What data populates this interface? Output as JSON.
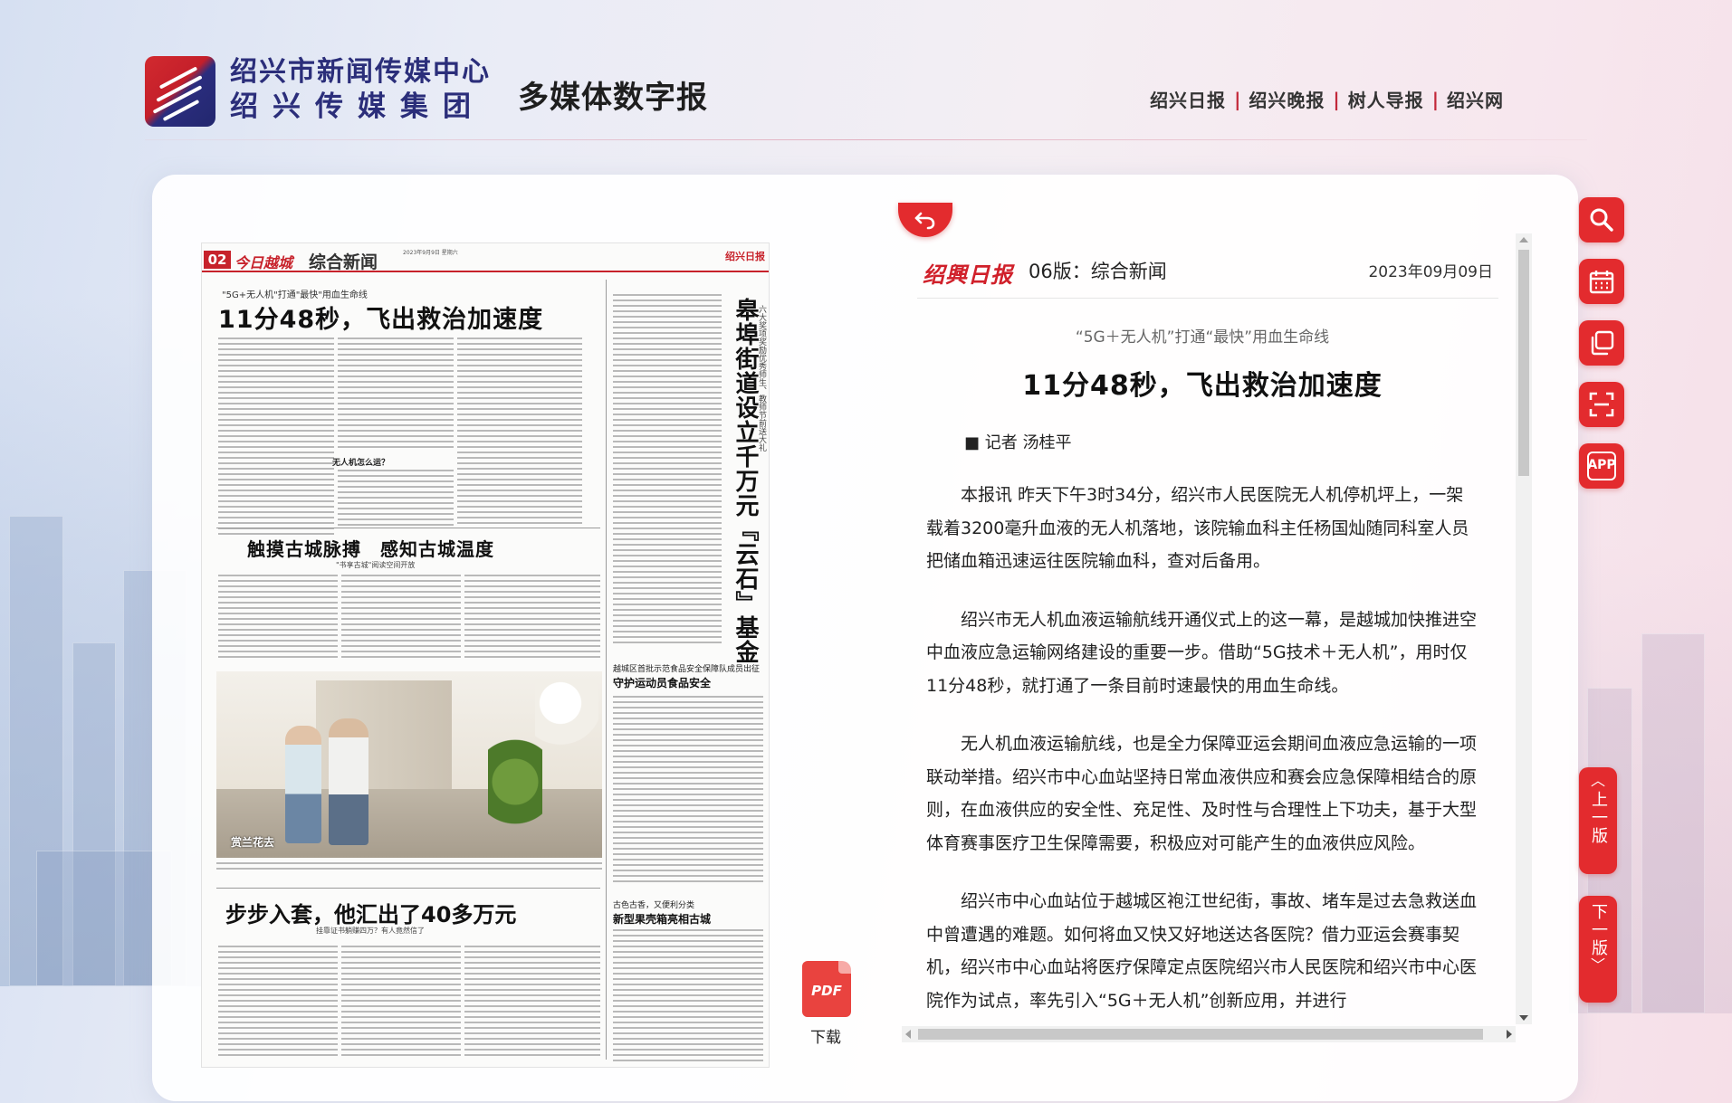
{
  "header": {
    "org_line1": "绍兴市新闻传媒中心",
    "org_line2": "绍兴传媒集团",
    "site_title": "多媒体数字报",
    "nav": [
      "绍兴日报",
      "绍兴晚报",
      "树人导报",
      "绍兴网"
    ],
    "nav_separator": "|"
  },
  "newspaper_page": {
    "page_number": "02",
    "brand": "今日越城",
    "section": "综合新闻",
    "meta_date": "2023年9月9日 星期六",
    "right_logo": "绍兴日报",
    "kicker": "\"5G+无人机\"打通\"最快\"用血生命线",
    "headline": "11分48秒，飞出救治加速度",
    "vertical_title": "皋埠街道设立千万元『云石』基金",
    "vertical_subtitle": "六大奖项奖励优秀师生、教师节前送大礼",
    "box_label": "无人机怎么运？",
    "headline2": "触摸古城脉搏　感知古城温度",
    "headline2_sub": "\"书享古城\"阅读空间开放",
    "mid_kicker": "越城区首批示范食品安全保障队成员出征",
    "mid_title": "守护运动员食品安全",
    "photo_caption": "赏兰花去",
    "headline3": "步步入套，他汇出了40多万元",
    "headline3_sub": "挂靠证书躺赚四万？有人竟然信了",
    "low_kicker": "古色古香，又便利分类",
    "low_title": "新型果壳箱亮相古城"
  },
  "pdf": {
    "icon_label": "PDF",
    "download_label": "下载"
  },
  "article": {
    "brand": "绍興日报",
    "edition": "06版：综合新闻",
    "date": "2023年09月09日",
    "kicker": "“5G＋无人机”打通“最快”用血生命线",
    "title": "11分48秒，飞出救治加速度",
    "byline": "■ 记者 汤桂平",
    "paragraphs": [
      "本报讯 昨天下午3时34分，绍兴市人民医院无人机停机坪上，一架载着3200毫升血液的无人机落地，该院输血科主任杨国灿随同科室人员把储血箱迅速运往医院输血科，查对后备用。",
      "绍兴市无人机血液运输航线开通仪式上的这一幕，是越城加快推进空中血液应急运输网络建设的重要一步。借助“5G技术＋无人机”，用时仅11分48秒，就打通了一条目前时速最快的用血生命线。",
      "无人机血液运输航线，也是全力保障亚运会期间血液应急运输的一项联动举措。绍兴市中心血站坚持日常血液供应和赛会应急保障相结合的原则，在血液供应的安全性、充足性、及时性与合理性上下功夫，基于大型体育赛事医疗卫生保障需要，积极应对可能产生的血液供应风险。",
      "绍兴市中心血站位于越城区袍江世纪街，事故、堵车是过去急救送血中曾遭遇的难题。如何将血又快又好地送达各医院？借力亚运会赛事契机，绍兴市中心血站将医疗保障定点医院绍兴市人民医院和绍兴市中心医院作为试点，率先引入“5G＋无人机”创新应用，并进行"
    ]
  },
  "side_tools": {
    "app_label": "APP",
    "prev_page": "上一版",
    "next_page": "下一版"
  },
  "colors": {
    "accent_red": "#e32b2e",
    "logo_blue": "#2b2e7a"
  }
}
